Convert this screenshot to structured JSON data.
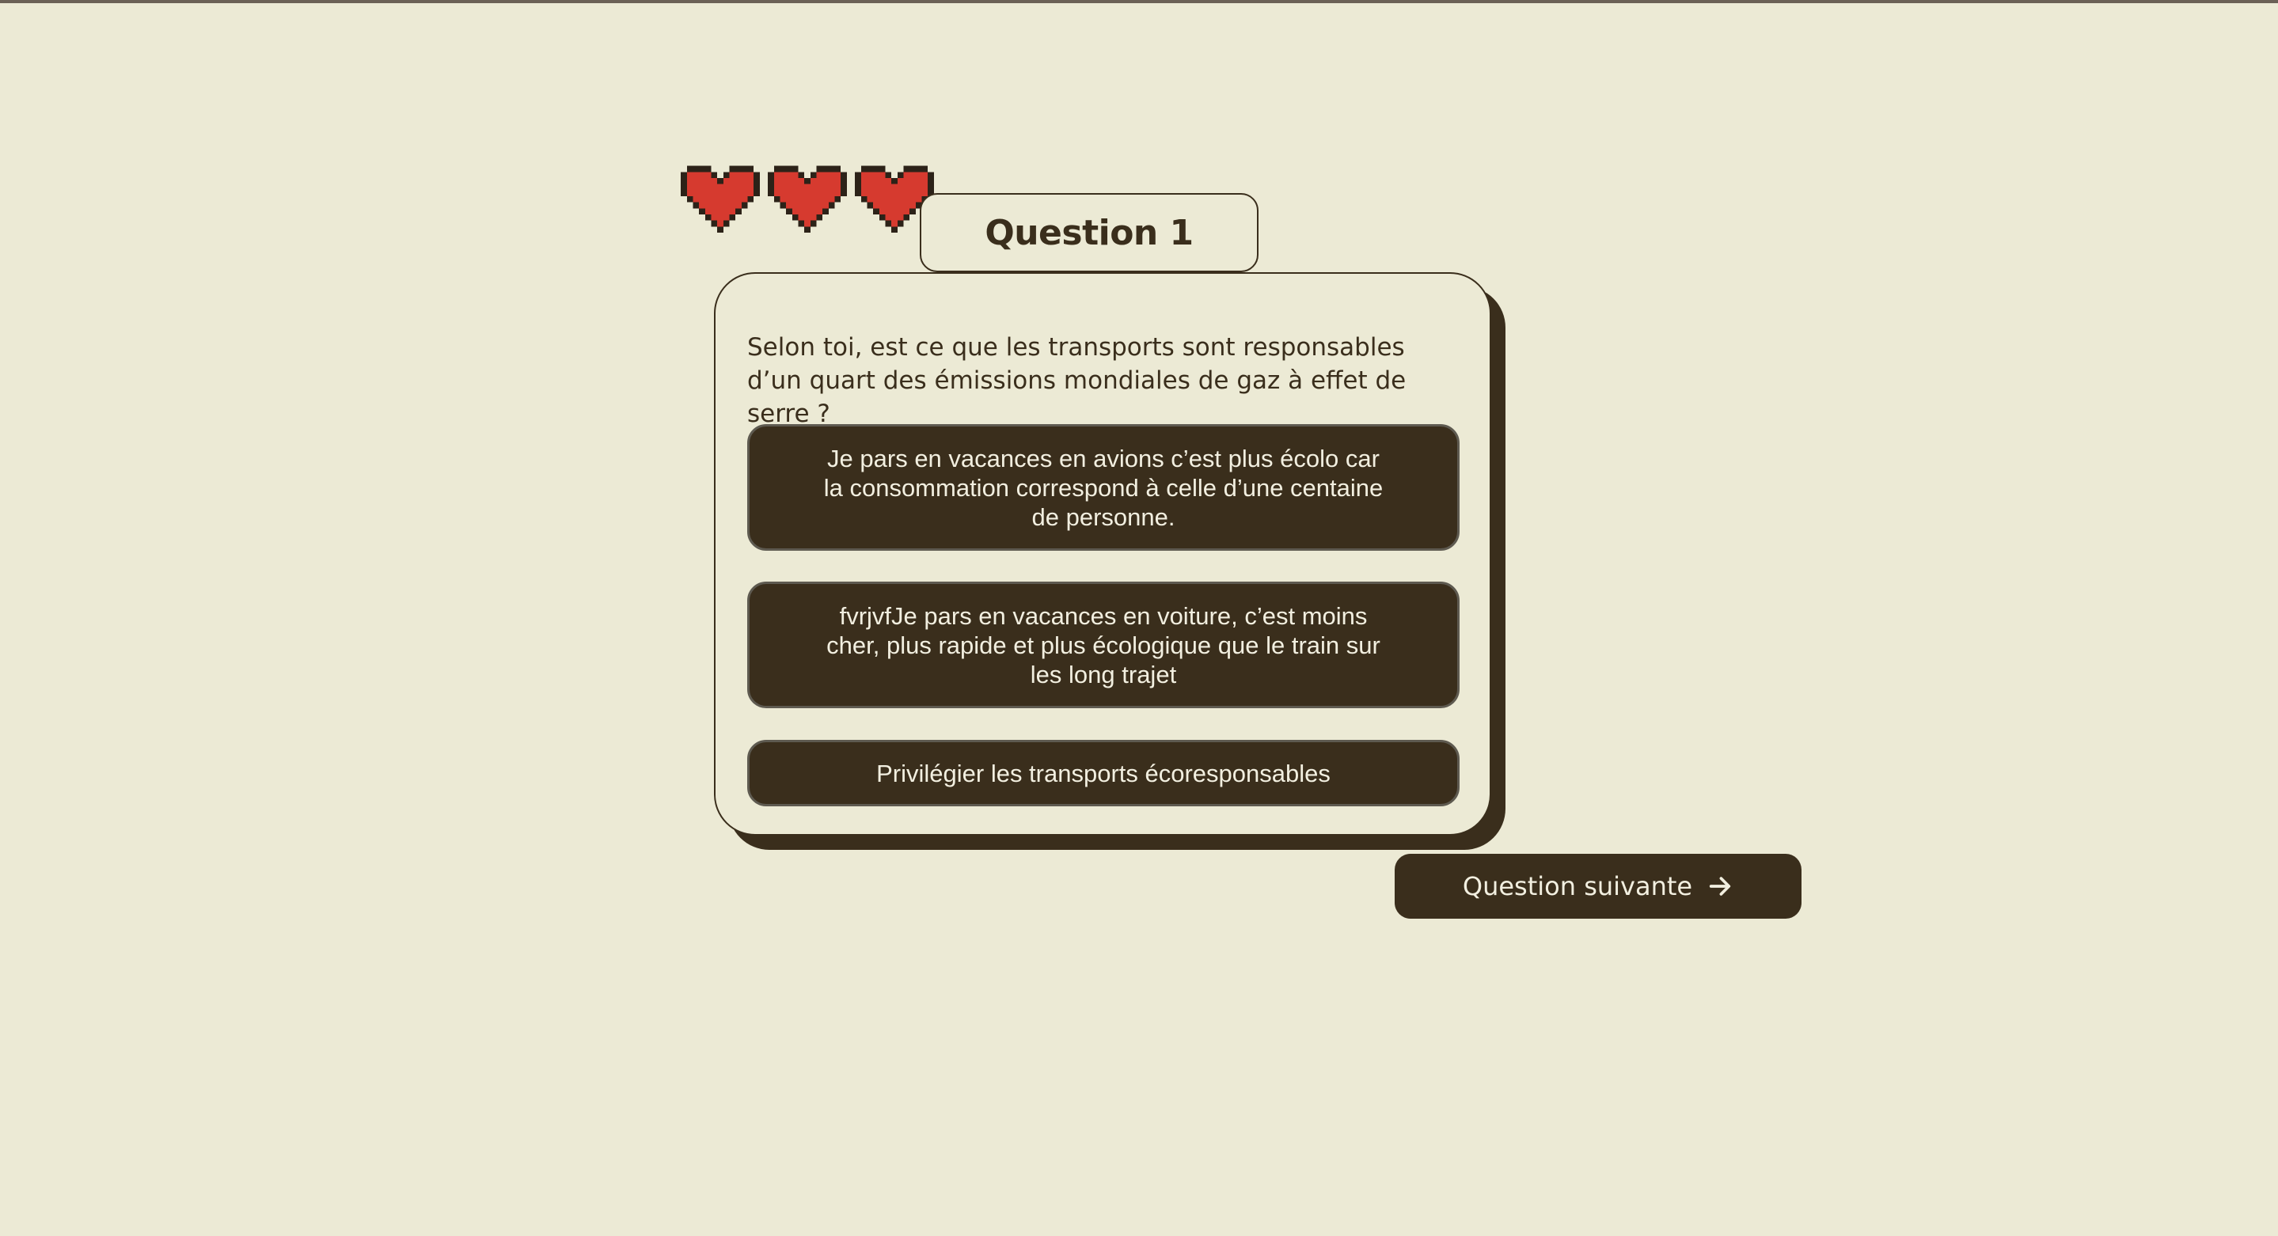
{
  "colors": {
    "background": "#eceAd5",
    "dark_brown": "#3a2e1c",
    "heart_red": "#d63a2f",
    "button_text": "#f2efe0"
  },
  "lives": {
    "count": 3,
    "icon": "pixel-heart-icon"
  },
  "question": {
    "tab_label": "Question 1",
    "text": "Selon toi, est ce que les transports sont responsables d’un quart des émissions mondiales de gaz à effet de serre ?"
  },
  "answers": [
    {
      "label": "Je pars en vacances en avions c’est plus écolo car la consommation correspond à celle d’une centaine de personne."
    },
    {
      "label": "fvrjvfJe pars en vacances en voiture, c’est moins cher, plus rapide et plus écologique que le train sur les long trajet"
    },
    {
      "label": "Privilégier les transports écoresponsables"
    }
  ],
  "next_button": {
    "label": "Question suivante",
    "icon": "arrow-right-icon"
  }
}
